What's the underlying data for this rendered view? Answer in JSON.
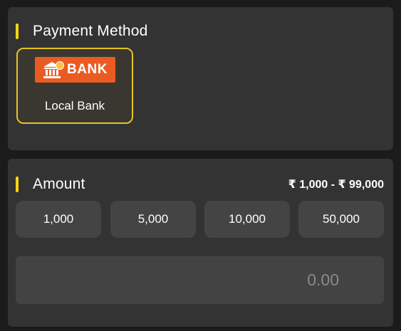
{
  "payment_method": {
    "title": "Payment Method",
    "methods": [
      {
        "logo_text": "BANK",
        "label": "Local Bank",
        "selected": true
      }
    ]
  },
  "amount": {
    "title": "Amount",
    "range": "₹ 1,000 - ₹ 99,000",
    "presets": [
      "1,000",
      "5,000",
      "10,000",
      "50,000"
    ],
    "input_placeholder": "0.00",
    "input_value": ""
  },
  "colors": {
    "accent": "#f5d516",
    "selected_border": "#e6c422",
    "bank_logo_bg": "#ea5b22",
    "card_bg": "#333333",
    "page_bg": "#1b1b1b"
  },
  "icons": {
    "bank_logo": "bank-building-coin-icon"
  }
}
